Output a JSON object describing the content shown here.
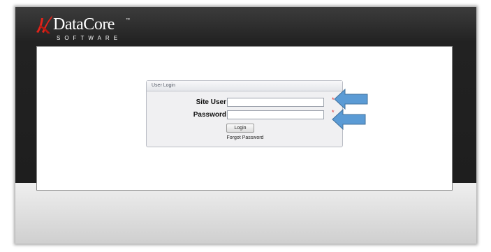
{
  "brand": {
    "name": "DataCore",
    "trademark": "™",
    "tagline": "SOFTWARE"
  },
  "login": {
    "panel_title": "User Login",
    "username_label": "Site User",
    "username_value": "",
    "password_label": "Password",
    "password_value": "",
    "required_marker": "*",
    "login_button": "Login",
    "forgot_link": "Forgot Password"
  },
  "colors": {
    "header_bg": "#1e1e1e",
    "required": "#dd2222",
    "annotation_arrow": "#5b9bd5",
    "logo_mark": "#e2231a"
  },
  "icons": {
    "logo": "datacore-swoosh-icon",
    "annotation": "left-arrow-icon"
  }
}
